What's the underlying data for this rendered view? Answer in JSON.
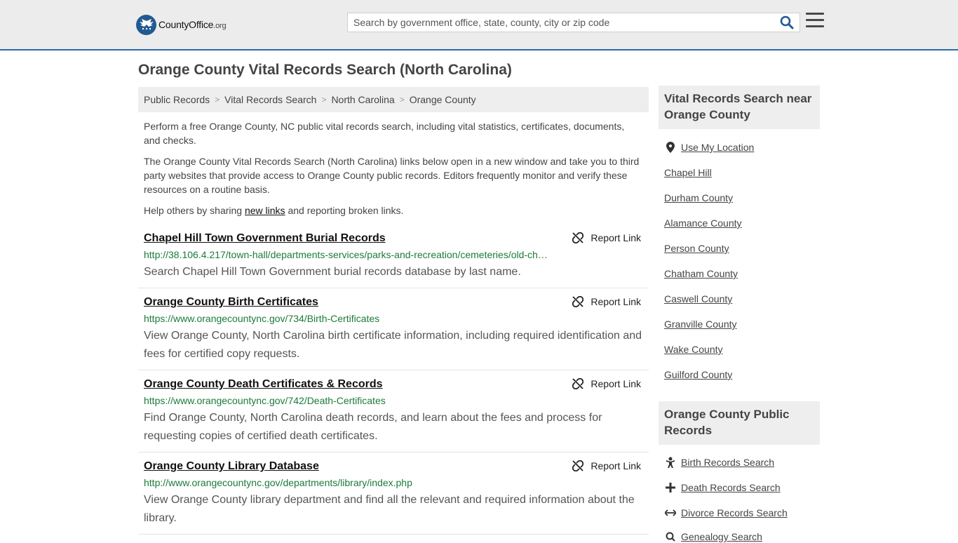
{
  "header": {
    "logo_brand": "CountyOffice",
    "logo_tld": ".org",
    "search_placeholder": "Search by government office, state, county, city or zip code"
  },
  "page_title": "Orange County Vital Records Search (North Carolina)",
  "breadcrumb": [
    "Public Records",
    "Vital Records Search",
    "North Carolina",
    "Orange County"
  ],
  "intro": {
    "p1": "Perform a free Orange County, NC public vital records search, including vital statistics, certificates, documents, and checks.",
    "p2": "The Orange County Vital Records Search (North Carolina) links below open in a new window and take you to third party websites that provide access to Orange County public records. Editors frequently monitor and verify these resources on a routine basis.",
    "p3_before": "Help others by sharing ",
    "p3_link": "new links",
    "p3_after": " and reporting broken links."
  },
  "report_label": "Report Link",
  "results": [
    {
      "title": "Chapel Hill Town Government Burial Records",
      "url": "http://38.106.4.217/town-hall/departments-services/parks-and-recreation/cemeteries/old-ch…",
      "desc": "Search Chapel Hill Town Government burial records database by last name."
    },
    {
      "title": "Orange County Birth Certificates",
      "url": "https://www.orangecountync.gov/734/Birth-Certificates",
      "desc": "View Orange County, North Carolina birth certificate information, including required identification and fees for certified copy requests."
    },
    {
      "title": "Orange County Death Certificates & Records",
      "url": "https://www.orangecountync.gov/742/Death-Certificates",
      "desc": "Find Orange County, North Carolina death records, and learn about the fees and process for requesting copies of certified death certificates."
    },
    {
      "title": "Orange County Library Database",
      "url": "http://www.orangecountync.gov/departments/library/index.php",
      "desc": "View Orange County library department and find all the relevant and required information about the library."
    }
  ],
  "sidebar": {
    "nearby_title": "Vital Records Search near Orange County",
    "use_location": "Use My Location",
    "nearby": [
      "Chapel Hill",
      "Durham County",
      "Alamance County",
      "Person County",
      "Chatham County",
      "Caswell County",
      "Granville County",
      "Wake County",
      "Guilford County"
    ],
    "public_title": "Orange County Public Records",
    "public_links": [
      {
        "label": "Birth Records Search",
        "icon": "baby-icon"
      },
      {
        "label": "Death Records Search",
        "icon": "cross-icon"
      },
      {
        "label": "Divorce Records Search",
        "icon": "arrows-icon"
      },
      {
        "label": "Genealogy Search",
        "icon": "search-icon"
      }
    ]
  }
}
